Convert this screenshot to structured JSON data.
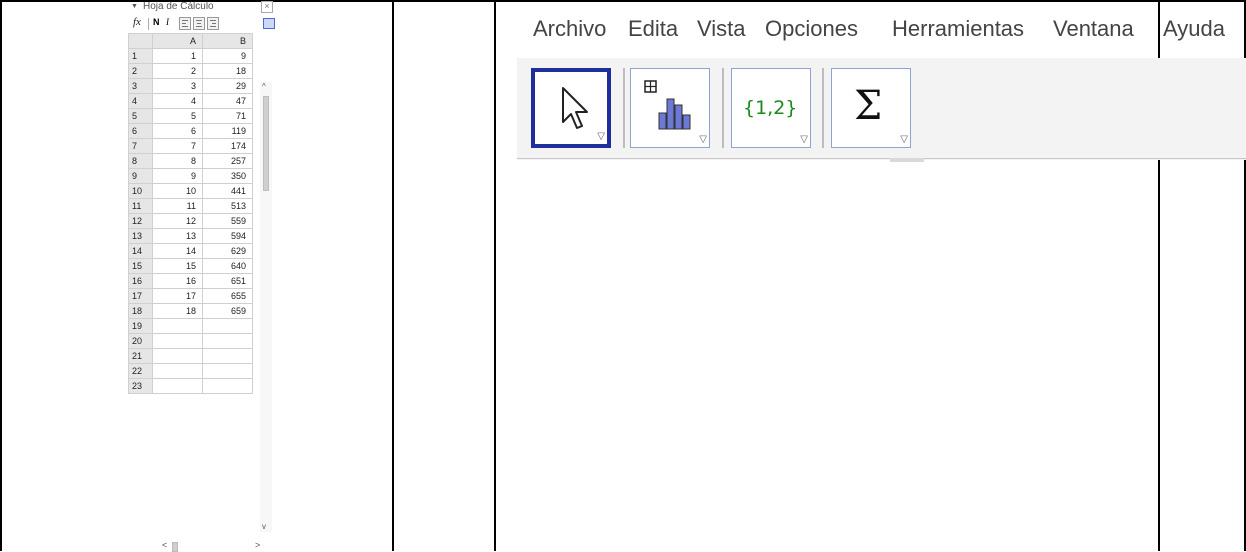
{
  "spreadsheet": {
    "title": "Hoja de Cálculo",
    "close_glyph": "×",
    "collapse_glyph": "▼",
    "toolbar": {
      "fx": "fx",
      "bold": "N",
      "italic": "I",
      "cell_style_icon": "cell-border-icon"
    },
    "columns": [
      "A",
      "B"
    ],
    "rows": [
      {
        "n": "1",
        "a": "1",
        "b": "9"
      },
      {
        "n": "2",
        "a": "2",
        "b": "18"
      },
      {
        "n": "3",
        "a": "3",
        "b": "29"
      },
      {
        "n": "4",
        "a": "4",
        "b": "47"
      },
      {
        "n": "5",
        "a": "5",
        "b": "71"
      },
      {
        "n": "6",
        "a": "6",
        "b": "119"
      },
      {
        "n": "7",
        "a": "7",
        "b": "174"
      },
      {
        "n": "8",
        "a": "8",
        "b": "257"
      },
      {
        "n": "9",
        "a": "9",
        "b": "350"
      },
      {
        "n": "10",
        "a": "10",
        "b": "441"
      },
      {
        "n": "11",
        "a": "11",
        "b": "513"
      },
      {
        "n": "12",
        "a": "12",
        "b": "559"
      },
      {
        "n": "13",
        "a": "13",
        "b": "594"
      },
      {
        "n": "14",
        "a": "14",
        "b": "629"
      },
      {
        "n": "15",
        "a": "15",
        "b": "640"
      },
      {
        "n": "16",
        "a": "16",
        "b": "651"
      },
      {
        "n": "17",
        "a": "17",
        "b": "655"
      },
      {
        "n": "18",
        "a": "18",
        "b": "659"
      },
      {
        "n": "19",
        "a": "",
        "b": ""
      },
      {
        "n": "20",
        "a": "",
        "b": ""
      },
      {
        "n": "21",
        "a": "",
        "b": ""
      },
      {
        "n": "22",
        "a": "",
        "b": ""
      },
      {
        "n": "23",
        "a": "",
        "b": ""
      }
    ],
    "scroll": {
      "up": "^",
      "down": "v",
      "left": "<",
      "right": ">"
    }
  },
  "menubar": {
    "items": [
      "Archivo",
      "Edita",
      "Vista",
      "Opciones",
      "Herramientas",
      "Ventana",
      "Ayuda"
    ]
  },
  "toolbar": {
    "tools": [
      {
        "icon": "arrow-pointer-icon",
        "selected": true
      },
      {
        "icon": "bar-chart-icon",
        "selected": false
      },
      {
        "icon": "list-set-icon",
        "label": "{1,2}",
        "selected": false
      },
      {
        "icon": "sigma-icon",
        "label": "Σ",
        "selected": false
      }
    ],
    "menu_triangle": "▽"
  },
  "colors": {
    "selected_tool_border": "#1e2f9b",
    "tool_border": "#8ea3cf",
    "set_icon_text": "#1b8a1b",
    "chart_bars": "#6d79d6"
  }
}
